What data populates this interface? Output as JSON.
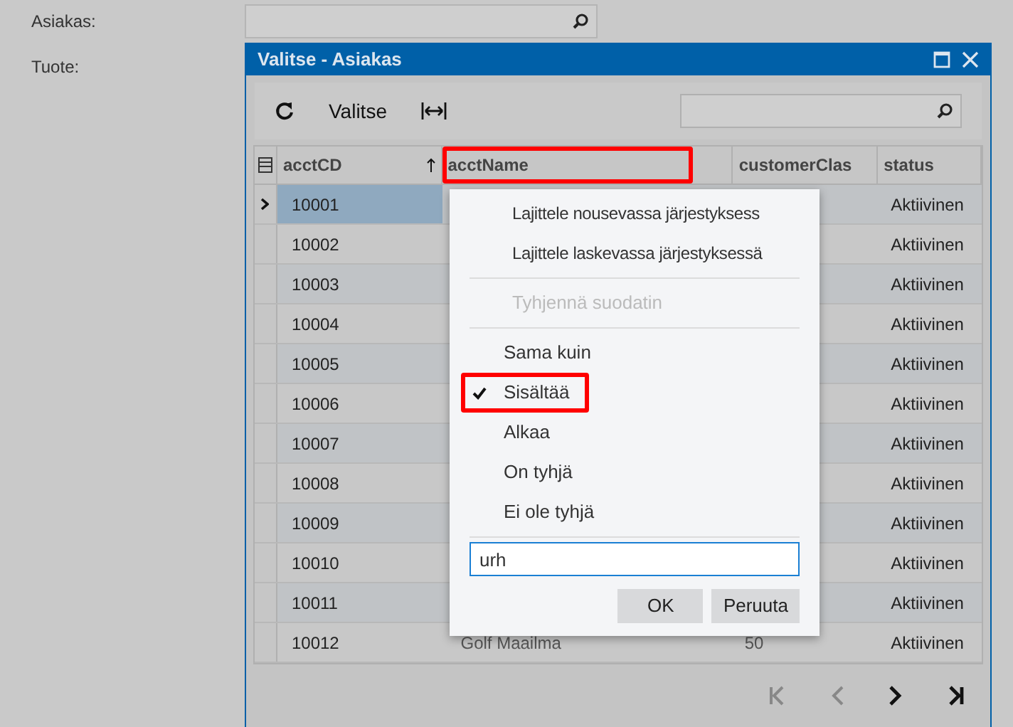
{
  "form": {
    "fields": [
      {
        "label": "Asiakas:",
        "kind": "lookup"
      },
      {
        "label": "Tuote:",
        "kind": "label"
      }
    ]
  },
  "dialog": {
    "title": "Valitse - Asiakas",
    "toolbar": {
      "select_label": "Valitse"
    },
    "columns": [
      {
        "label": "acctCD",
        "sorted": true,
        "highlighted": false
      },
      {
        "label": "acctName",
        "sorted": false,
        "highlighted": true
      },
      {
        "label": "customerClas",
        "sorted": false,
        "highlighted": false
      },
      {
        "label": "status",
        "sorted": false,
        "highlighted": false
      }
    ],
    "rows": [
      {
        "acctCD": "10001",
        "status": "Aktiivinen",
        "selected": true
      },
      {
        "acctCD": "10002",
        "status": "Aktiivinen",
        "selected": false
      },
      {
        "acctCD": "10003",
        "status": "Aktiivinen",
        "selected": false
      },
      {
        "acctCD": "10004",
        "status": "Aktiivinen",
        "selected": false
      },
      {
        "acctCD": "10005",
        "status": "Aktiivinen",
        "selected": false
      },
      {
        "acctCD": "10006",
        "status": "Aktiivinen",
        "selected": false
      },
      {
        "acctCD": "10007",
        "status": "Aktiivinen",
        "selected": false
      },
      {
        "acctCD": "10008",
        "status": "Aktiivinen",
        "selected": false
      },
      {
        "acctCD": "10009",
        "status": "Aktiivinen",
        "selected": false
      },
      {
        "acctCD": "10010",
        "status": "Aktiivinen",
        "selected": false
      },
      {
        "acctCD": "10011",
        "status": "Aktiivinen",
        "selected": false
      },
      {
        "acctCD": "10012",
        "acctName": "Golf Maailma",
        "customerClass": "50",
        "status": "Aktiivinen",
        "selected": false
      }
    ]
  },
  "column_menu": {
    "sort_items": [
      "Lajittele nousevassa järjestyksess",
      "Lajittele laskevassa järjestyksessä"
    ],
    "clear_filter": {
      "label": "Tyhjennä suodatin",
      "disabled": true
    },
    "conditions": [
      {
        "label": "Sama kuin",
        "checked": false,
        "highlighted": false
      },
      {
        "label": "Sisältää",
        "checked": true,
        "highlighted": true
      },
      {
        "label": "Alkaa",
        "checked": false,
        "highlighted": false
      },
      {
        "label": "On tyhjä",
        "checked": false,
        "highlighted": false
      },
      {
        "label": "Ei ole tyhjä",
        "checked": false,
        "highlighted": false
      }
    ],
    "filter_value": "urh",
    "buttons": [
      "OK",
      "Peruuta"
    ]
  }
}
